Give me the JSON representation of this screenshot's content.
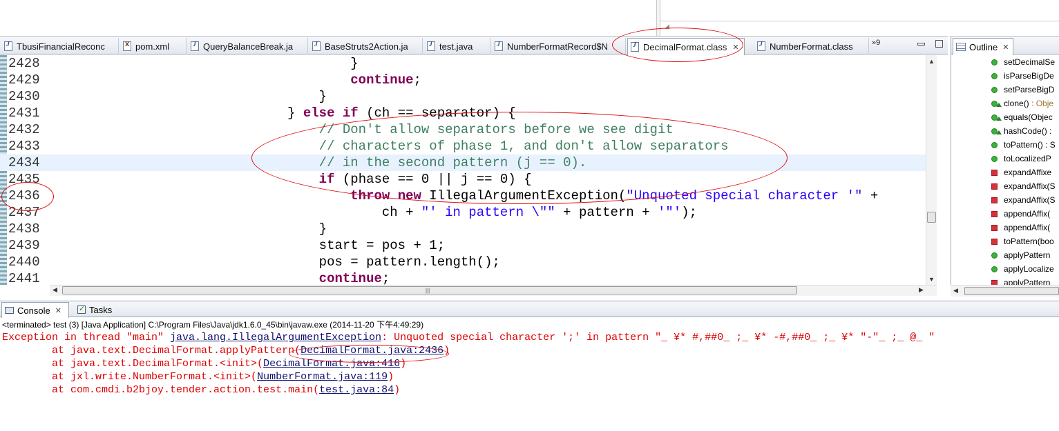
{
  "editor": {
    "tabs": [
      {
        "label": "TbusiFinancialReconc",
        "icon": "java-file-icon"
      },
      {
        "label": "pom.xml",
        "icon": "xml-file-icon"
      },
      {
        "label": "QueryBalanceBreak.ja",
        "icon": "java-file-icon"
      },
      {
        "label": "BaseStruts2Action.ja",
        "icon": "java-file-icon"
      },
      {
        "label": "test.java",
        "icon": "java-file-icon"
      },
      {
        "label": "NumberFormatRecord$N",
        "icon": "java-file-icon"
      },
      {
        "label": "DecimalFormat.class",
        "icon": "class-file-icon",
        "active": true
      },
      {
        "label": "NumberFormat.class",
        "icon": "class-file-icon"
      }
    ],
    "overflow_label": "»9",
    "current_line": "2434",
    "lines": [
      {
        "num": "2428",
        "parts": [
          {
            "t": "                                      }",
            "c": ""
          }
        ]
      },
      {
        "num": "2429",
        "parts": [
          {
            "t": "                                      ",
            "c": ""
          },
          {
            "t": "continue",
            "c": "kw"
          },
          {
            "t": ";",
            "c": ""
          }
        ]
      },
      {
        "num": "2430",
        "parts": [
          {
            "t": "                                  }",
            "c": ""
          }
        ]
      },
      {
        "num": "2431",
        "parts": [
          {
            "t": "                              } ",
            "c": ""
          },
          {
            "t": "else if",
            "c": "kw"
          },
          {
            "t": " (ch == separator) {",
            "c": ""
          }
        ]
      },
      {
        "num": "2432",
        "parts": [
          {
            "t": "                                  ",
            "c": ""
          },
          {
            "t": "// Don't allow separators before we see digit",
            "c": "cm"
          }
        ]
      },
      {
        "num": "2433",
        "parts": [
          {
            "t": "                                  ",
            "c": ""
          },
          {
            "t": "// characters of phase 1, and don't allow separators",
            "c": "cm"
          }
        ]
      },
      {
        "num": "2434",
        "parts": [
          {
            "t": "                                  ",
            "c": ""
          },
          {
            "t": "// in the second pattern (j == 0).",
            "c": "cm"
          }
        ]
      },
      {
        "num": "2435",
        "parts": [
          {
            "t": "                                  ",
            "c": ""
          },
          {
            "t": "if",
            "c": "kw"
          },
          {
            "t": " (phase == 0 || j == 0) {",
            "c": ""
          }
        ]
      },
      {
        "num": "2436",
        "parts": [
          {
            "t": "                                      ",
            "c": ""
          },
          {
            "t": "throw new",
            "c": "kw"
          },
          {
            "t": " IllegalArgumentException(",
            "c": ""
          },
          {
            "t": "\"Unquoted special character '\"",
            "c": "st"
          },
          {
            "t": " +",
            "c": ""
          }
        ]
      },
      {
        "num": "2437",
        "parts": [
          {
            "t": "                                          ch + ",
            "c": ""
          },
          {
            "t": "\"' in pattern \\\"\"",
            "c": "st"
          },
          {
            "t": " + pattern + ",
            "c": ""
          },
          {
            "t": "'\"'",
            "c": "st"
          },
          {
            "t": ");",
            "c": ""
          }
        ]
      },
      {
        "num": "2438",
        "parts": [
          {
            "t": "                                  }",
            "c": ""
          }
        ]
      },
      {
        "num": "2439",
        "parts": [
          {
            "t": "                                  start = pos + 1;",
            "c": ""
          }
        ]
      },
      {
        "num": "2440",
        "parts": [
          {
            "t": "                                  pos = pattern.length();",
            "c": ""
          }
        ]
      },
      {
        "num": "2441",
        "parts": [
          {
            "t": "                                  ",
            "c": ""
          },
          {
            "t": "continue",
            "c": "kw"
          },
          {
            "t": ";",
            "c": ""
          }
        ]
      }
    ]
  },
  "outline": {
    "title": "Outline",
    "items": [
      {
        "label": "setDecimalSe",
        "kind": "public"
      },
      {
        "label": "isParseBigDe",
        "kind": "public"
      },
      {
        "label": "setParseBigD",
        "kind": "public"
      },
      {
        "label": "clone()",
        "type": " : Obje",
        "kind": "public-override"
      },
      {
        "label": "equals(Objec",
        "kind": "public-override"
      },
      {
        "label": "hashCode() :",
        "kind": "public-override"
      },
      {
        "label": "toPattern() : S",
        "kind": "public"
      },
      {
        "label": "toLocalizedP",
        "kind": "public"
      },
      {
        "label": "expandAffixe",
        "kind": "private"
      },
      {
        "label": "expandAffix(S",
        "kind": "private"
      },
      {
        "label": "expandAffix(S",
        "kind": "private"
      },
      {
        "label": "appendAffix(",
        "kind": "private"
      },
      {
        "label": "appendAffix(",
        "kind": "private"
      },
      {
        "label": "toPattern(boo",
        "kind": "private"
      },
      {
        "label": "applyPattern",
        "kind": "public"
      },
      {
        "label": "applyLocalize",
        "kind": "public"
      },
      {
        "label": "applyPattern",
        "kind": "private"
      }
    ]
  },
  "console": {
    "tabs": [
      {
        "label": "Console"
      },
      {
        "label": "Tasks"
      }
    ],
    "status": "<terminated> test (3) [Java Application] C:\\Program Files\\Java\\jdk1.6.0_45\\bin\\javaw.exe (2014-11-20 下午4:49:29)",
    "exception_prefix": "Exception in thread \"main\" ",
    "exception_class": "java.lang.IllegalArgumentException",
    "exception_message": ": Unquoted special character ';' in pattern \"_ ¥* #,##0_ ;_ ¥* -#,##0_ ;_ ¥* \"-\"_ ;_ @_ \"",
    "stack": [
      {
        "prefix": "        at java.text.DecimalFormat.applyPattern(",
        "link": "DecimalFormat.java:2436",
        "suffix": ")"
      },
      {
        "prefix": "        at java.text.DecimalFormat.<init>(",
        "link": "DecimalFormat.java:416",
        "suffix": ")"
      },
      {
        "prefix": "        at jxl.write.NumberFormat.<init>(",
        "link": "NumberFormat.java:119",
        "suffix": ")"
      },
      {
        "prefix": "        at com.cmdi.b2bjoy.tender.action.test.main(",
        "link": "test.java:84",
        "suffix": ")"
      }
    ]
  },
  "colors": {
    "keyword": "#7f0055",
    "comment": "#3f7f5f",
    "string": "#2a00ff",
    "error": "#e00000",
    "annotation": "#e01010",
    "current_line": "#e8f2fe"
  }
}
